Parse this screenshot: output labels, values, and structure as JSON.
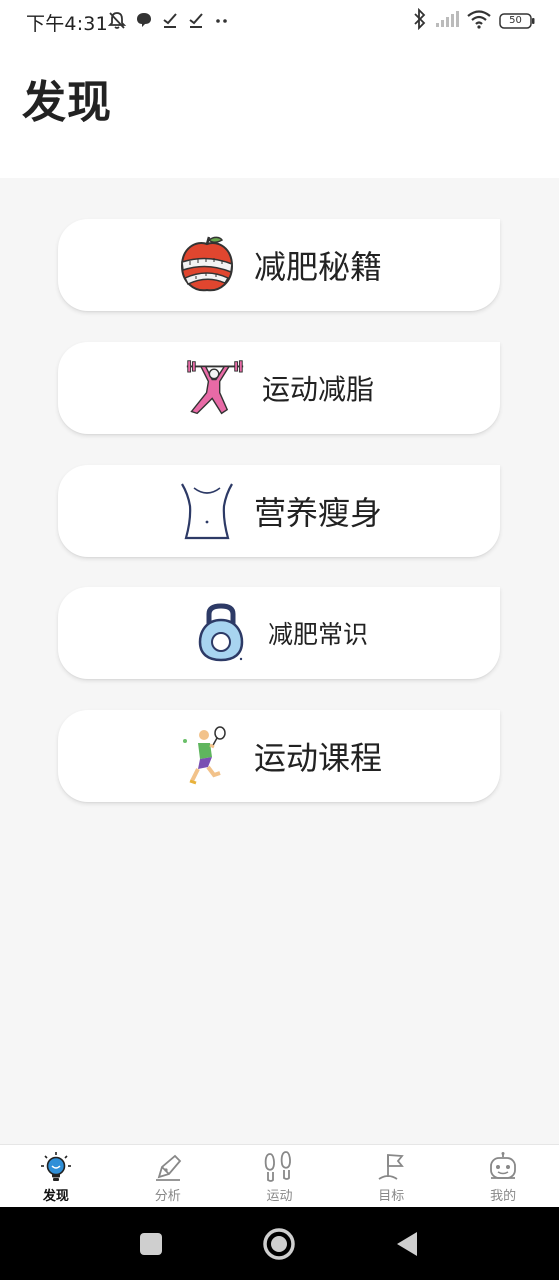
{
  "status_bar": {
    "time": "下午4:31",
    "battery": "50",
    "icons": [
      "bell-off-icon",
      "chat-bubble-icon",
      "check-icon",
      "check-icon",
      "dots-icon",
      "bluetooth-icon",
      "signal-icon",
      "wifi-icon",
      "battery-icon"
    ]
  },
  "header": {
    "title": "发现"
  },
  "cards": [
    {
      "label": "减肥秘籍",
      "icon": "apple-measuring-tape-icon"
    },
    {
      "label": "运动减脂",
      "icon": "weightlifter-icon"
    },
    {
      "label": "营养瘦身",
      "icon": "slim-waist-icon"
    },
    {
      "label": "减肥常识",
      "icon": "kettlebell-icon"
    },
    {
      "label": "运动课程",
      "icon": "badminton-player-icon"
    }
  ],
  "tab_bar": {
    "tabs": [
      {
        "label": "发现",
        "icon": "lightbulb-icon",
        "active": true
      },
      {
        "label": "分析",
        "icon": "pen-icon",
        "active": false
      },
      {
        "label": "运动",
        "icon": "footprints-icon",
        "active": false
      },
      {
        "label": "目标",
        "icon": "flag-icon",
        "active": false
      },
      {
        "label": "我的",
        "icon": "robot-face-icon",
        "active": false
      }
    ]
  },
  "nav_bar": {
    "buttons": [
      "recents-square-icon",
      "home-circle-icon",
      "back-triangle-icon"
    ]
  },
  "colors": {
    "background": "#f6f6f6",
    "card": "#ffffff",
    "text": "#222222",
    "tab_inactive": "#888888",
    "accent_blue": "#2f8fd8"
  }
}
